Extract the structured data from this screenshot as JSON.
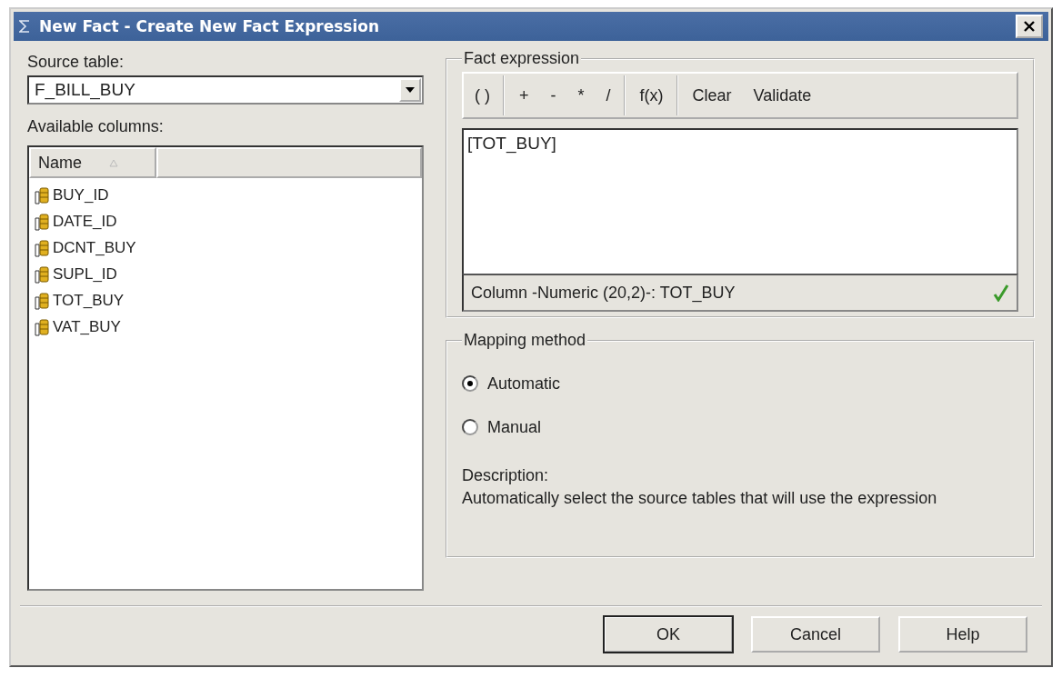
{
  "window": {
    "title": "New Fact - Create New Fact Expression"
  },
  "source_table": {
    "label": "Source table:",
    "value": "F_BILL_BUY"
  },
  "available_columns": {
    "label": "Available columns:",
    "header": [
      {
        "label": "Name",
        "sorted": true
      }
    ],
    "items": [
      {
        "name": "BUY_ID"
      },
      {
        "name": "DATE_ID"
      },
      {
        "name": "DCNT_BUY"
      },
      {
        "name": "SUPL_ID"
      },
      {
        "name": "TOT_BUY"
      },
      {
        "name": "VAT_BUY"
      }
    ]
  },
  "fact_expression": {
    "title": "Fact expression",
    "toolbar": [
      [
        "( )"
      ],
      [
        "+",
        "-",
        "*",
        "/"
      ],
      [
        "f(x)"
      ],
      [
        "Clear",
        "Validate"
      ]
    ],
    "expression": "[TOT_BUY]",
    "status": "Column -Numeric (20,2)-: TOT_BUY",
    "valid": true
  },
  "mapping_method": {
    "title": "Mapping method",
    "options": [
      {
        "label": "Automatic",
        "selected": true
      },
      {
        "label": "Manual",
        "selected": false
      }
    ],
    "description_label": "Description:",
    "description": "Automatically select the source tables that will use the expression"
  },
  "buttons": [
    {
      "label": "OK",
      "default": true
    },
    {
      "label": "Cancel",
      "default": false
    },
    {
      "label": "Help",
      "default": false
    }
  ]
}
